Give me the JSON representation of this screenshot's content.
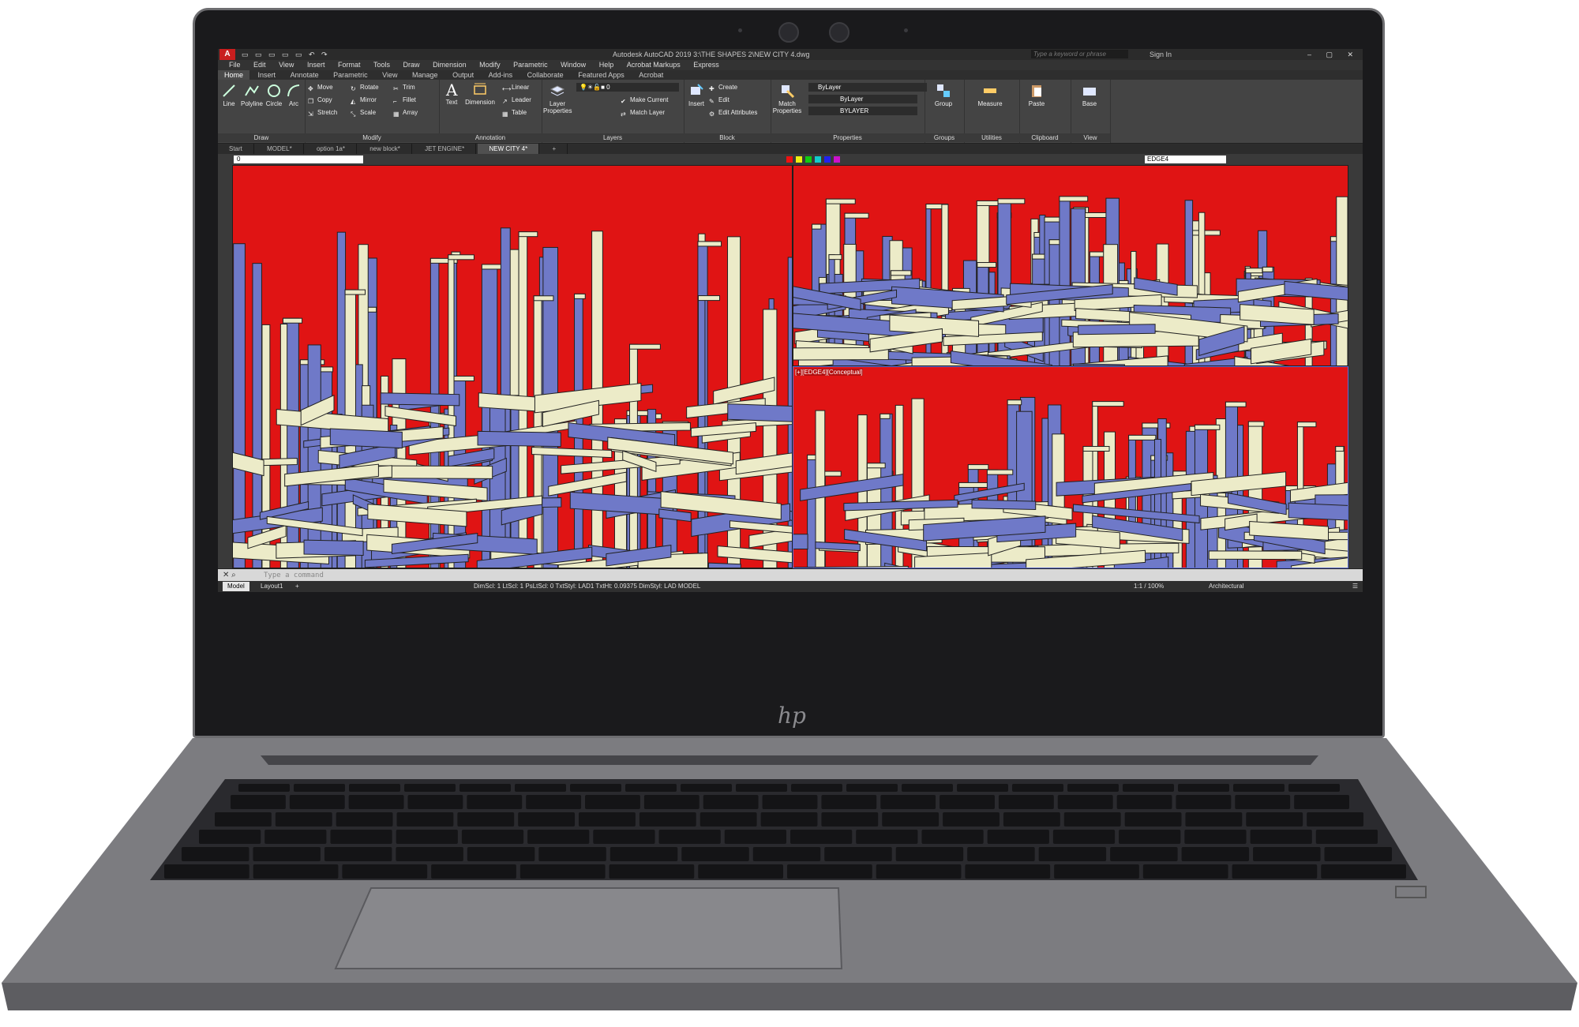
{
  "titlebar": {
    "app_logo": "A",
    "title": "Autodesk AutoCAD 2019    3:\\THE SHAPES 2\\NEW CITY 4.dwg",
    "search_placeholder": "Type a keyword or phrase",
    "sign_in": "Sign In"
  },
  "menu": [
    "File",
    "Edit",
    "View",
    "Insert",
    "Format",
    "Tools",
    "Draw",
    "Dimension",
    "Modify",
    "Parametric",
    "Window",
    "Help",
    "Acrobat Markups",
    "Express"
  ],
  "ribbon_tabs": [
    "Home",
    "Insert",
    "Annotate",
    "Parametric",
    "View",
    "Manage",
    "Output",
    "Add-ins",
    "Collaborate",
    "Featured Apps",
    "Acrobat"
  ],
  "ribbon": {
    "draw": {
      "label": "Draw",
      "tools": [
        "Line",
        "Polyline",
        "Circle",
        "Arc"
      ]
    },
    "modify": {
      "label": "Modify",
      "tools": [
        "Move",
        "Rotate",
        "Trim",
        "Copy",
        "Mirror",
        "Fillet",
        "Stretch",
        "Scale",
        "Array"
      ]
    },
    "annotation": {
      "label": "Annotation",
      "tools": [
        "Text",
        "Dimension",
        "Linear",
        "Leader",
        "Table"
      ]
    },
    "layers": {
      "label": "Layers",
      "tools": [
        "Layer Properties",
        "Make Current",
        "Match Layer"
      ],
      "current_layer": "0"
    },
    "block": {
      "label": "Block",
      "tools": [
        "Insert",
        "Create",
        "Edit",
        "Edit Attributes"
      ]
    },
    "properties": {
      "label": "Properties",
      "tools": [
        "Match Properties"
      ],
      "bylayer_1": "ByLayer",
      "bylayer_2": "ByLayer",
      "bylayer_3": "BYLAYER"
    },
    "groups": {
      "label": "Groups",
      "tools": [
        "Group"
      ]
    },
    "utilities": {
      "label": "Utilities",
      "tools": [
        "Measure"
      ]
    },
    "clipboard": {
      "label": "Clipboard",
      "tools": [
        "Paste"
      ]
    },
    "view": {
      "label": "View",
      "tools": [
        "Base"
      ]
    }
  },
  "doc_tabs": [
    "Start",
    "MODEL*",
    "option 1a*",
    "new block*",
    "JET ENGINE*",
    "NEW CITY 4*"
  ],
  "toolrow": {
    "layer": "0",
    "visual_style": "EDGE4"
  },
  "viewport_label": "[+][EDGE4][Conceptual]",
  "command": {
    "placeholder": "Type a command"
  },
  "layout_tabs": [
    "Model",
    "Layout1"
  ],
  "status": {
    "text": "DimScl: 1  LtScl: 1  PsLtScl: 0  TxtStyl: LAD1  TxtHt: 0.09375  DimStyl: LAD   MODEL",
    "scale": "1:1 / 100%",
    "units": "Architectural"
  },
  "brand": "hp",
  "colors": {
    "viewport_bg": "#e01414",
    "shape_blue": "#6f79c8",
    "shape_cream": "#ecebc8",
    "ui_dark": "#3b3b3b"
  }
}
